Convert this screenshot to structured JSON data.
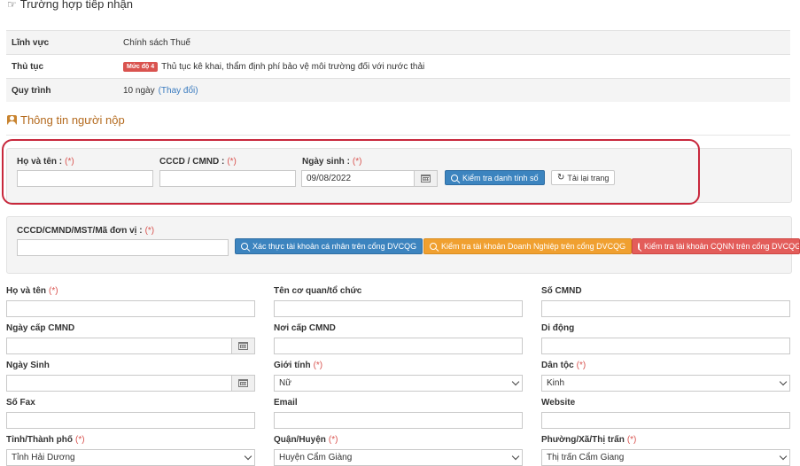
{
  "case_section": {
    "icon": "hand-point-right-icon",
    "title": "Trường hợp tiếp nhận",
    "rows": [
      {
        "label": "Lĩnh vực",
        "value": "Chính sách Thuế"
      },
      {
        "label": "Thủ tục",
        "badge": "Mức độ 4",
        "value": "Thủ tục kê khai, thẩm định phí bảo vệ môi trường đối với nước thải"
      },
      {
        "label": "Quy trình",
        "value": "10 ngày",
        "link": "(Thay đổi)"
      }
    ]
  },
  "submitter_section": {
    "icon": "user-icon",
    "title": "Thông tin người nộp"
  },
  "identity_check": {
    "full_name_label": "Họ và tên :",
    "id_label": "CCCD / CMND :",
    "dob_label": "Ngày sinh :",
    "dob_value": "09/08/2022",
    "required_mark": "(*)",
    "check_button": "Kiểm tra danh tính số",
    "reload_button": "Tải lại trang"
  },
  "account_check": {
    "label": "CCCD/CMND/MST/Mã đơn vị :",
    "required_mark": "(*)",
    "btn_personal": "Xác thực tài khoản cá nhân trên cổng DVCQG",
    "btn_business": "Kiểm tra tài khoản Doanh Nghiệp trên cổng DVCQG",
    "btn_agency": "Kiểm tra tài khoản CQNN trên cổng DVCQG"
  },
  "form": {
    "required_mark": "(*)",
    "ho_va_ten": "Họ và tên",
    "ten_co_quan": "Tên cơ quan/tổ chức",
    "so_cmnd": "Số CMND",
    "ngay_cap": "Ngày cấp CMND",
    "noi_cap": "Nơi cấp CMND",
    "di_dong": "Di động",
    "ngay_sinh": "Ngày Sinh",
    "gioi_tinh": "Giới tính",
    "gioi_tinh_value": "Nữ",
    "dan_toc": "Dân tộc",
    "dan_toc_value": "Kinh",
    "so_fax": "Số Fax",
    "email": "Email",
    "website": "Website",
    "tinh": "Tỉnh/Thành phố",
    "tinh_value": "Tỉnh Hải Dương",
    "huyen": "Quận/Huyện",
    "huyen_value": "Huyện Cẩm Giàng",
    "xa": "Phường/Xã/Thị trấn",
    "xa_value": "Thị trấn Cẩm Giang"
  },
  "colors": {
    "badge_red": "#d9534f",
    "primary_blue": "#3c84bf",
    "warning_orange": "#f0a030",
    "danger_red": "#e35d5a",
    "highlight_frame": "#c8283c",
    "section_orange": "#b46a1e"
  }
}
